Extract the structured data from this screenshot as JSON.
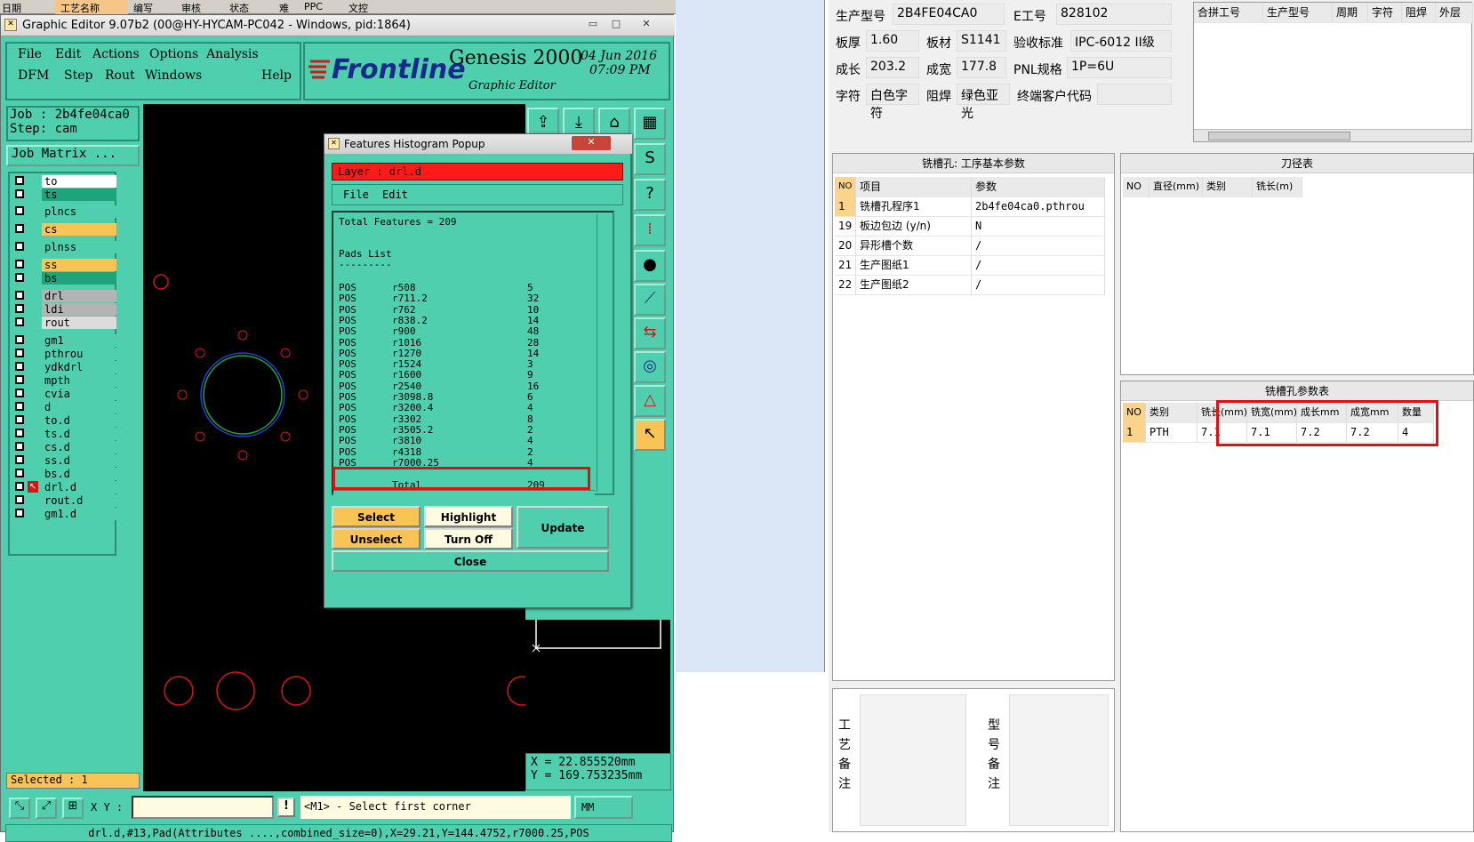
{
  "background_strip": {
    "items": [
      "日期",
      "工艺名称",
      "编写",
      "审核",
      "状态",
      "难",
      "PPC",
      "文控"
    ]
  },
  "genesis_window": {
    "title": "Graphic Editor 9.07b2 (00@HY-HYCAM-PC042 - Windows, pid:1864)",
    "menus_row1": [
      "File",
      "Edit",
      "Actions",
      "Options",
      "Analysis"
    ],
    "menus_row2": [
      "DFM",
      "Step",
      "Rout",
      "Windows",
      "Help"
    ],
    "logo_text": "Frontline",
    "product": "Genesis 2000",
    "product_sub": "Graphic Editor",
    "date": "04 Jun 2016",
    "time": "07:09 PM",
    "job": "Job : 2b4fe04ca0",
    "step": "Step: cam",
    "job_matrix": "Job Matrix ...",
    "layers": [
      {
        "name": "to",
        "color": "#ffffff"
      },
      {
        "name": "ts",
        "color": "#1fa37a"
      },
      {
        "name": "plncs",
        "color": "#4fcfae"
      },
      {
        "name": "cs",
        "color": "#f9c456"
      },
      {
        "name": "plnss",
        "color": "#4fcfae"
      },
      {
        "name": "ss",
        "color": "#f9c456"
      },
      {
        "name": "bs",
        "color": "#1fa37a"
      },
      {
        "name": "drl",
        "color": "#b4b4b4"
      },
      {
        "name": "ldi",
        "color": "#b4b4b4"
      },
      {
        "name": "rout",
        "color": "#dcdcdc"
      },
      {
        "name": "gm1",
        "color": "#4fcfae"
      },
      {
        "name": "pthrou",
        "color": "#4fcfae"
      },
      {
        "name": "ydkdrl",
        "color": "#4fcfae"
      },
      {
        "name": "mpth",
        "color": "#4fcfae"
      },
      {
        "name": "cvia",
        "color": "#4fcfae"
      },
      {
        "name": "d",
        "color": "#4fcfae"
      },
      {
        "name": "to.d",
        "color": "#4fcfae"
      },
      {
        "name": "ts.d",
        "color": "#4fcfae"
      },
      {
        "name": "cs.d",
        "color": "#4fcfae"
      },
      {
        "name": "ss.d",
        "color": "#4fcfae"
      },
      {
        "name": "bs.d",
        "color": "#4fcfae"
      },
      {
        "name": "drl.d",
        "color": "#4fcfae"
      },
      {
        "name": "rout.d",
        "color": "#4fcfae"
      },
      {
        "name": "gm1.d",
        "color": "#4fcfae"
      }
    ],
    "selected": "Selected : 1",
    "coord_x": "X = 22.855520mm",
    "coord_y": "Y = 169.753235mm",
    "xy_label": "X Y :",
    "prompt": "<M1> - Select first corner",
    "units": "MM",
    "status": "drl.d,#13,Pad(Attributes ....,combined_size=0),X=29.21,Y=144.4752,r7000.25,POS"
  },
  "popup": {
    "title": "Features Histogram Popup",
    "layer": "Layer :  drl.d",
    "menu": [
      "File",
      "Edit"
    ],
    "total": "Total Features = 209",
    "pads_title": "Pads List",
    "pads_rule": "---------",
    "pads": [
      [
        "POS",
        "r508",
        "5"
      ],
      [
        "POS",
        "r711.2",
        "32"
      ],
      [
        "POS",
        "r762",
        "10"
      ],
      [
        "POS",
        "r838.2",
        "14"
      ],
      [
        "POS",
        "r900",
        "48"
      ],
      [
        "POS",
        "r1016",
        "28"
      ],
      [
        "POS",
        "r1270",
        "14"
      ],
      [
        "POS",
        "r1524",
        "3"
      ],
      [
        "POS",
        "r1600",
        "9"
      ],
      [
        "POS",
        "r2540",
        "16"
      ],
      [
        "POS",
        "r3098.8",
        "6"
      ],
      [
        "POS",
        "r3200.4",
        "4"
      ],
      [
        "POS",
        "r3302",
        "8"
      ],
      [
        "POS",
        "r3505.2",
        "2"
      ],
      [
        "POS",
        "r3810",
        "4"
      ],
      [
        "POS",
        "r4318",
        "2"
      ],
      [
        "POS",
        "r7000.25",
        "4"
      ]
    ],
    "total_label": "Total",
    "total_value": "209",
    "buttons": {
      "select": "Select",
      "highlight": "Highlight",
      "update": "Update",
      "unselect": "Unselect",
      "turnoff": "Turn Off",
      "close": "Close"
    }
  },
  "form": {
    "fields": [
      {
        "label": "生产型号",
        "value": "2B4FE04CA0"
      },
      {
        "label": "E工号",
        "value": "828102"
      },
      {
        "label": "板厚",
        "value": "1.60"
      },
      {
        "label": "板材",
        "value": "S1141"
      },
      {
        "label": "验收标准",
        "value": "IPC-6012 II级"
      },
      {
        "label": "成长",
        "value": "203.2"
      },
      {
        "label": "成宽",
        "value": "177.8"
      },
      {
        "label": "PNL规格",
        "value": "1P=6U"
      },
      {
        "label": "字符",
        "value": "白色字符"
      },
      {
        "label": "阻焊",
        "value": "绿色亚光"
      },
      {
        "label": "终端客户代码",
        "value": ""
      }
    ],
    "top_table_headers": [
      "合拼工号",
      "生产型号",
      "周期",
      "字符",
      "阻焊",
      "外层"
    ],
    "mill_basic": {
      "title": "铣槽孔: 工序基本参数",
      "headers": [
        "NO",
        "项目",
        "参数"
      ],
      "rows": [
        [
          "1",
          "铣槽孔程序1",
          "2b4fe04ca0.pthrou"
        ],
        [
          "19",
          "板边包边 (y/n)",
          "N"
        ],
        [
          "20",
          "异形槽个数",
          "/"
        ],
        [
          "21",
          "生产图纸1",
          "/"
        ],
        [
          "22",
          "生产图纸2",
          "/"
        ]
      ]
    },
    "tool_table": {
      "title": "刀径表",
      "headers": [
        "NO",
        "直径(mm)",
        "类别",
        "铣长(m)"
      ]
    },
    "mill_params": {
      "title": "铣槽孔参数表",
      "headers": [
        "NO",
        "类别",
        "铣长(mm)",
        "铣宽(mm)",
        "成长mm",
        "成宽mm",
        "数量"
      ],
      "rows": [
        [
          "1",
          "PTH",
          "7.1",
          "7.1",
          "7.2",
          "7.2",
          "4"
        ]
      ]
    },
    "process_note_label": "工艺备注",
    "model_note_label": "型号备注"
  }
}
